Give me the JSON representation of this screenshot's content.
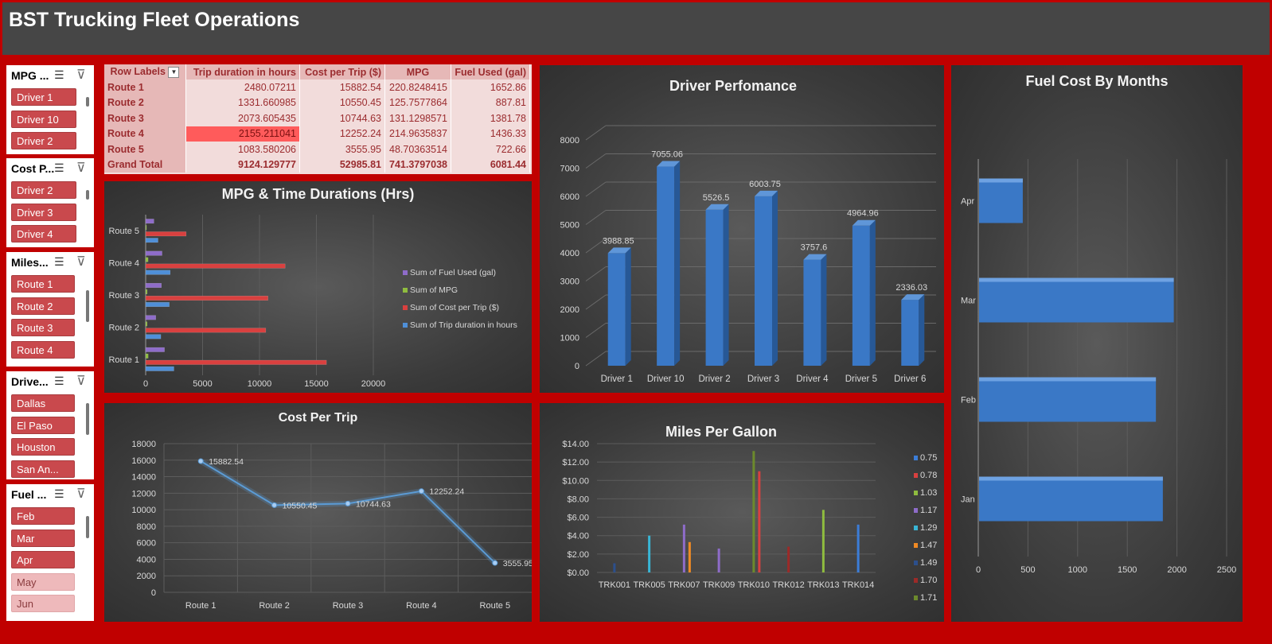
{
  "app": {
    "title": "BST Trucking Fleet Operations"
  },
  "slicers": [
    {
      "title": "MPG ...",
      "items": [
        "Driver 1",
        "Driver 10",
        "Driver 2"
      ],
      "states": [
        "on",
        "on",
        "on"
      ]
    },
    {
      "title": "Cost P...",
      "items": [
        "Driver 2",
        "Driver 3",
        "Driver 4"
      ],
      "states": [
        "on",
        "on",
        "on"
      ]
    },
    {
      "title": "Miles...",
      "items": [
        "Route 1",
        "Route 2",
        "Route 3",
        "Route 4"
      ],
      "states": [
        "on",
        "on",
        "on",
        "on"
      ]
    },
    {
      "title": "Drive...",
      "items": [
        "Dallas",
        "El Paso",
        "Houston",
        "San An..."
      ],
      "states": [
        "on",
        "on",
        "on",
        "on"
      ]
    },
    {
      "title": "Fuel ...",
      "items": [
        "Feb",
        "Mar",
        "Apr",
        "May",
        "Jun"
      ],
      "states": [
        "on",
        "on",
        "on",
        "off",
        "off"
      ]
    }
  ],
  "pivot": {
    "headers": [
      "Row Labels",
      "Trip duration in hours",
      "Cost per Trip ($)",
      "MPG",
      "Fuel Used (gal)"
    ],
    "rows": [
      {
        "label": "Route 1",
        "cells": [
          "2480.07211",
          "15882.54",
          "220.8248415",
          "1652.86"
        ]
      },
      {
        "label": "Route 2",
        "cells": [
          "1331.660985",
          "10550.45",
          "125.7577864",
          "887.81"
        ]
      },
      {
        "label": "Route 3",
        "cells": [
          "2073.605435",
          "10744.63",
          "131.1298571",
          "1381.78"
        ]
      },
      {
        "label": "Route 4",
        "cells": [
          "2155.211041",
          "12252.24",
          "214.9635837",
          "1436.33"
        ]
      },
      {
        "label": "Route 5",
        "cells": [
          "1083.580206",
          "3555.95",
          "48.70363514",
          "722.66"
        ]
      }
    ],
    "total": {
      "label": "Grand Total",
      "cells": [
        "9124.129777",
        "52985.81",
        "741.3797038",
        "6081.44"
      ]
    }
  },
  "colors": {
    "frame": "#c00000",
    "bar_blue": "#3a78c6",
    "bar_red": "#d9403f",
    "line_blue": "#5b9bd5"
  },
  "chart_data": [
    {
      "id": "mpg_time",
      "type": "bar",
      "orientation": "horizontal",
      "title": "MPG & Time Durations (Hrs)",
      "categories": [
        "Route 1",
        "Route 2",
        "Route 3",
        "Route 4",
        "Route 5"
      ],
      "series": [
        {
          "name": "Sum of Trip duration in hours",
          "values": [
            2480.07,
            1331.66,
            2073.61,
            2155.21,
            1083.58
          ],
          "color": "#4f8fd8"
        },
        {
          "name": "Sum of Cost per Trip ($)",
          "values": [
            15882.54,
            10550.45,
            10744.63,
            12252.24,
            3555.95
          ],
          "color": "#d9403f"
        },
        {
          "name": "Sum of MPG",
          "values": [
            220.82,
            125.76,
            131.13,
            214.96,
            48.7
          ],
          "color": "#8fbc3f"
        },
        {
          "name": "Sum of Fuel Used (gal)",
          "values": [
            1652.86,
            887.81,
            1381.78,
            1436.33,
            722.66
          ],
          "color": "#8e6cc9"
        }
      ],
      "legend_order": [
        "Sum of Fuel Used (gal)",
        "Sum of MPG",
        "Sum of Cost per Trip ($)",
        "Sum of Trip duration in hours"
      ],
      "xticks": [
        "0",
        "5000",
        "10000",
        "15000",
        "20000"
      ],
      "xlim": [
        0,
        20000
      ],
      "legend": "right"
    },
    {
      "id": "driver_perf",
      "type": "bar",
      "title": "Driver Perfomance",
      "categories": [
        "Driver 1",
        "Driver 10",
        "Driver 2",
        "Driver 3",
        "Driver 4",
        "Driver 5",
        "Driver 6"
      ],
      "values": [
        3988.85,
        7055.06,
        5526.5,
        6003.75,
        3757.6,
        4964.96,
        2336.03
      ],
      "labels": [
        "3988.85",
        "7055.06",
        "5526.5",
        "6003.75",
        "3757.6",
        "4964.96",
        "2336.03"
      ],
      "yticks": [
        "0",
        "1000",
        "2000",
        "3000",
        "4000",
        "5000",
        "6000",
        "7000",
        "8000"
      ],
      "ylim": [
        0,
        8000
      ],
      "grid": true
    },
    {
      "id": "fuel_months",
      "type": "bar",
      "orientation": "horizontal",
      "title": "Fuel Cost By Months",
      "categories": [
        "Jan",
        "Feb",
        "Mar",
        "Apr"
      ],
      "values": [
        1850,
        1780,
        1960,
        440
      ],
      "xticks": [
        "0",
        "500",
        "1000",
        "1500",
        "2000",
        "2500"
      ],
      "xlim": [
        0,
        2500
      ],
      "grid": true
    },
    {
      "id": "cost_trip",
      "type": "line",
      "title": "Cost Per Trip",
      "categories": [
        "Route 1",
        "Route 2",
        "Route 3",
        "Route 4",
        "Route 5"
      ],
      "values": [
        15882.54,
        10550.45,
        10744.63,
        12252.24,
        3555.95
      ],
      "labels": [
        "15882.54",
        "10550.45",
        "10744.63",
        "12252.24",
        "3555.95"
      ],
      "yticks": [
        "0",
        "2000",
        "4000",
        "6000",
        "8000",
        "10000",
        "12000",
        "14000",
        "16000",
        "18000"
      ],
      "ylim": [
        0,
        18000
      ],
      "grid": true
    },
    {
      "id": "mpg_gallon",
      "type": "bar",
      "title": "Miles Per Gallon",
      "categories": [
        "TRK001",
        "TRK005",
        "TRK007",
        "TRK009",
        "TRK010",
        "TRK012",
        "TRK013",
        "TRK014"
      ],
      "series": [
        {
          "name": "0.75",
          "color": "#3b7dd8"
        },
        {
          "name": "0.78",
          "color": "#d9403f"
        },
        {
          "name": "1.03",
          "color": "#8fbc3f"
        },
        {
          "name": "1.17",
          "color": "#8e6cc9"
        },
        {
          "name": "1.29",
          "color": "#38b6d6"
        },
        {
          "name": "1.47",
          "color": "#f08a24"
        },
        {
          "name": "1.49",
          "color": "#2c4f8c"
        },
        {
          "name": "1.70",
          "color": "#9c2a28"
        },
        {
          "name": "1.71",
          "color": "#6c8a2c"
        }
      ],
      "bars": [
        {
          "category": "TRK001",
          "series": "1.49",
          "value": 1.0
        },
        {
          "category": "TRK005",
          "series": "1.29",
          "value": 4.0
        },
        {
          "category": "TRK007",
          "series": "1.17",
          "value": 5.2
        },
        {
          "category": "TRK007",
          "series": "1.47",
          "value": 3.3
        },
        {
          "category": "TRK009",
          "series": "1.17",
          "value": 2.6
        },
        {
          "category": "TRK010",
          "series": "1.71",
          "value": 13.2
        },
        {
          "category": "TRK010",
          "series": "0.78",
          "value": 11.0
        },
        {
          "category": "TRK012",
          "series": "1.70",
          "value": 2.8
        },
        {
          "category": "TRK013",
          "series": "1.03",
          "value": 6.8
        },
        {
          "category": "TRK014",
          "series": "0.75",
          "value": 5.2
        }
      ],
      "yticks": [
        "$0.00",
        "$2.00",
        "$4.00",
        "$6.00",
        "$8.00",
        "$10.00",
        "$12.00",
        "$14.00"
      ],
      "ylim": [
        0,
        14
      ],
      "grid": true,
      "legend": "right"
    }
  ]
}
